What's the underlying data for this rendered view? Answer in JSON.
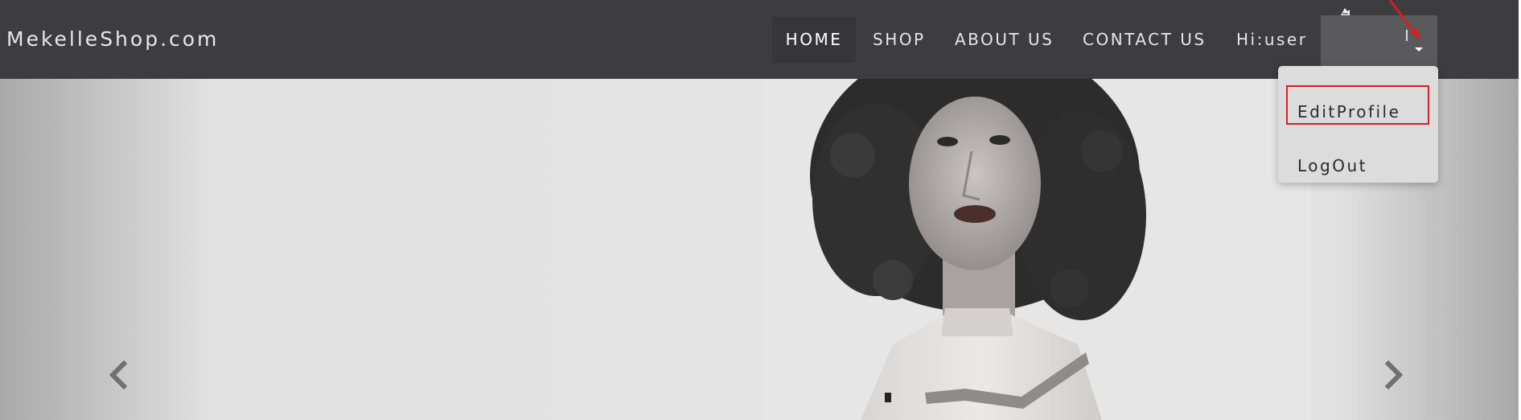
{
  "header": {
    "brand": "MekelleShop.com",
    "nav": [
      "HOME",
      "SHOP",
      "ABOUT US",
      "CONTACT US"
    ],
    "greeting": "Hi:user"
  },
  "user_menu": {
    "items": [
      "EditProfile",
      "LogOut"
    ],
    "highlighted": "EditProfile",
    "highlight_color": "#d41f26"
  },
  "carousel": {
    "prev_icon": "chevron-left-icon",
    "next_icon": "chevron-right-icon"
  },
  "colors": {
    "navbar": "#3d3d3f",
    "active_nav": "#363638",
    "dropdown": "#dcdcdc"
  }
}
